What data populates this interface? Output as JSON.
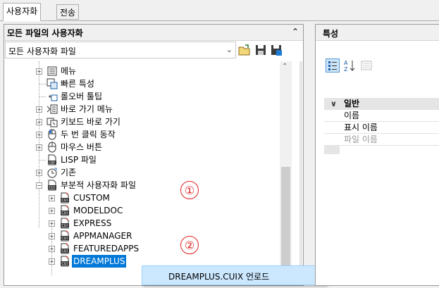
{
  "tabs": {
    "customize": "사용자화",
    "transfer": "전송"
  },
  "left_panel": {
    "title": "모든 파일의 사용자화",
    "combo_value": "모든 사용자화 파일",
    "tree": {
      "menu": "메뉴",
      "quick_props": "빠른 특성",
      "rollover": "롤오버 툴팁",
      "shortcut_menu": "바로 가기 메뉴",
      "keyboard": "키보드 바로 가기",
      "double_click": "두 번 클릭 동작",
      "mouse_buttons": "마우스 버튼",
      "lisp_files": "LISP 파일",
      "legacy": "기존",
      "partial": "부분적 사용자화 파일",
      "custom": "CUSTOM",
      "modeldoc": "MODELDOC",
      "express": "EXPRESS",
      "appmanager": "APPMANAGER",
      "featuredapps": "FEATUREDAPPS",
      "dreamplus": "DREAMPLUS"
    },
    "markers": {
      "one": "①",
      "two": "②"
    }
  },
  "context_menu": {
    "item": "DREAMPLUS.CUIX 언로드"
  },
  "right_panel": {
    "title": "특성",
    "grid": {
      "category": "일반",
      "name": "이름",
      "display_name": "표시 이름",
      "file_name": "파일 이름"
    }
  },
  "colors": {
    "selection": "#0078d7",
    "context_hover": "#cce8ff",
    "marker": "#e02020"
  }
}
